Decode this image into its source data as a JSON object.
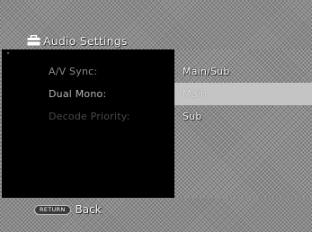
{
  "header": {
    "title": "Audio Settings",
    "icon": "toolbox-icon"
  },
  "menu": {
    "items": [
      {
        "label": "A/V Sync:"
      },
      {
        "label": "Dual Mono:"
      },
      {
        "label": "Decode Priority:"
      }
    ]
  },
  "options": {
    "items": [
      {
        "label": "Main/Sub"
      },
      {
        "label": "Main",
        "selected": true
      },
      {
        "label": "Sub"
      }
    ]
  },
  "footer": {
    "return_key": "RETURN",
    "back_label": "Back"
  },
  "colors": {
    "menu_panel": "#000000",
    "selected_option": "#c4c4c4",
    "text": "#ffffff"
  }
}
